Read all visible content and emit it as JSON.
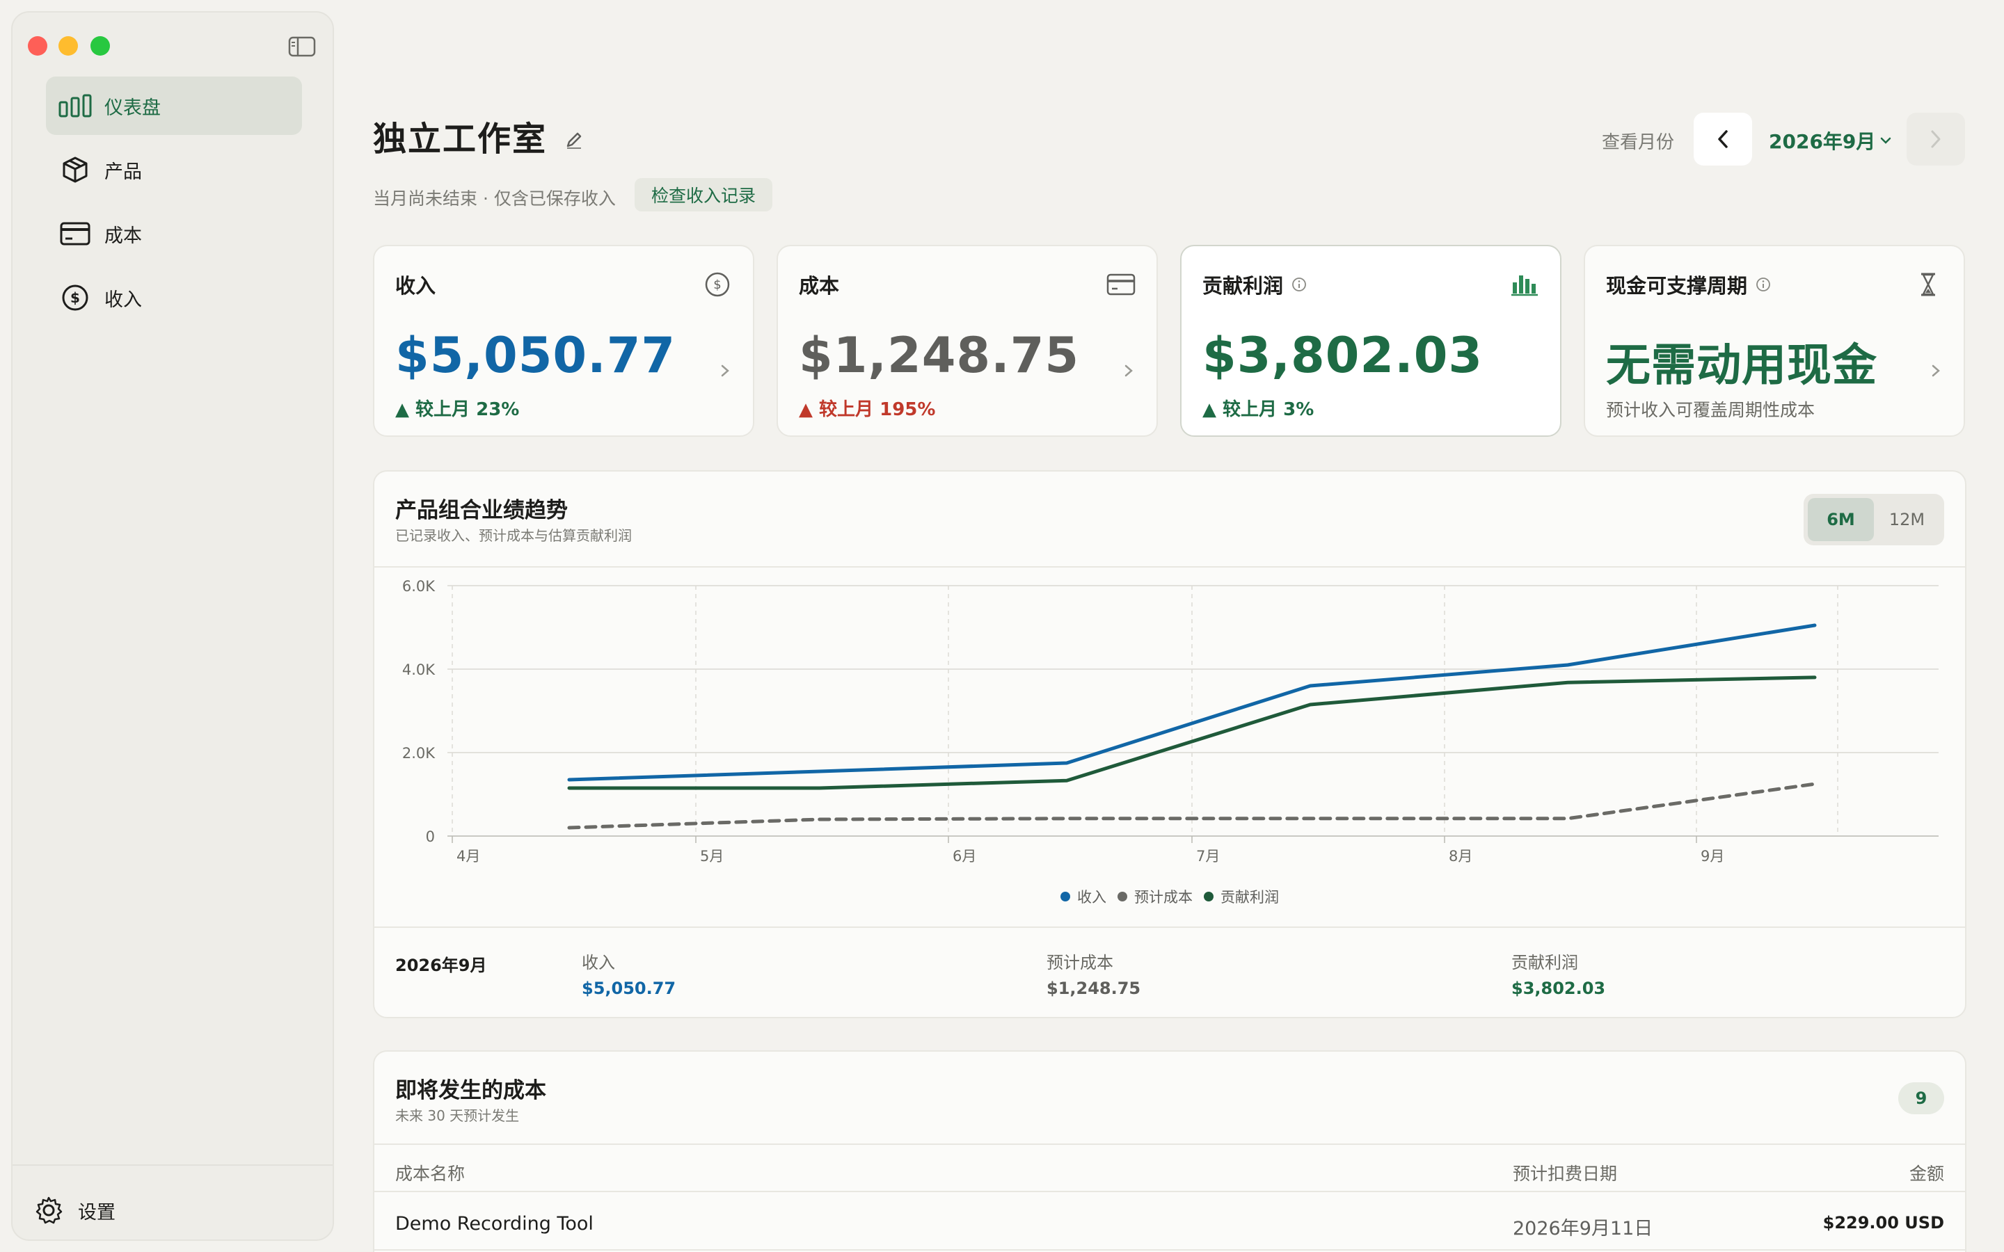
{
  "sidebar": {
    "items": [
      {
        "label": "仪表盘",
        "icon": "bar-chart-icon",
        "active": true
      },
      {
        "label": "产品",
        "icon": "cube-icon",
        "active": false
      },
      {
        "label": "成本",
        "icon": "credit-card-icon",
        "active": false
      },
      {
        "label": "收入",
        "icon": "dollar-circle-icon",
        "active": false
      }
    ],
    "settings_label": "设置"
  },
  "header": {
    "title": "独立工作室",
    "subtitle": "当月尚未结束 · 仅含已保存收入",
    "check_button": "检查收入记录",
    "month_label": "查看月份",
    "selected_month": "2026年9月"
  },
  "cards": {
    "revenue": {
      "title": "收入",
      "value": "$5,050.77",
      "delta": "▲ 较上月 23%"
    },
    "cost": {
      "title": "成本",
      "value": "$1,248.75",
      "delta": "▲ 较上月 195%"
    },
    "profit": {
      "title": "贡献利润",
      "value": "$3,802.03",
      "delta": "▲ 较上月 3%"
    },
    "runway": {
      "title": "现金可支撑周期",
      "value": "无需动用现金",
      "note": "预计收入可覆盖周期性成本"
    }
  },
  "trend": {
    "title": "产品组合业绩趋势",
    "subtitle": "已记录收入、预计成本与估算贡献利润",
    "range_options": [
      "6M",
      "12M"
    ],
    "selected_range": "6M",
    "summary_month": "2026年9月",
    "summary": [
      {
        "label": "收入",
        "value": "$5,050.77"
      },
      {
        "label": "预计成本",
        "value": "$1,248.75"
      },
      {
        "label": "贡献利润",
        "value": "$3,802.03"
      }
    ]
  },
  "chart_data": {
    "type": "line",
    "x": [
      "4月",
      "5月",
      "6月",
      "7月",
      "8月",
      "9月"
    ],
    "y_ticks": [
      "0",
      "2.0K",
      "4.0K",
      "6.0K"
    ],
    "ylim": [
      0,
      6000
    ],
    "grid": true,
    "legend_position": "bottom",
    "series": [
      {
        "name": "收入",
        "color": "#1166a6",
        "dashed": false,
        "values": [
          1350,
          1550,
          1750,
          3600,
          4100,
          5050.77
        ]
      },
      {
        "name": "预计成本",
        "color": "#6a6a66",
        "dashed": true,
        "values": [
          200,
          400,
          420,
          420,
          420,
          1248.75
        ]
      },
      {
        "name": "贡献利润",
        "color": "#1f5a3a",
        "dashed": false,
        "values": [
          1150,
          1150,
          1330,
          3150,
          3680,
          3802.03
        ]
      }
    ]
  },
  "costs": {
    "title": "即将发生的成本",
    "subtitle": "未来 30 天预计发生",
    "count": "9",
    "columns": [
      "成本名称",
      "预计扣费日期",
      "金额"
    ],
    "rows": [
      {
        "name": "Demo Recording Tool",
        "date": "2026年9月11日",
        "amount": "$229.00 USD"
      }
    ]
  }
}
